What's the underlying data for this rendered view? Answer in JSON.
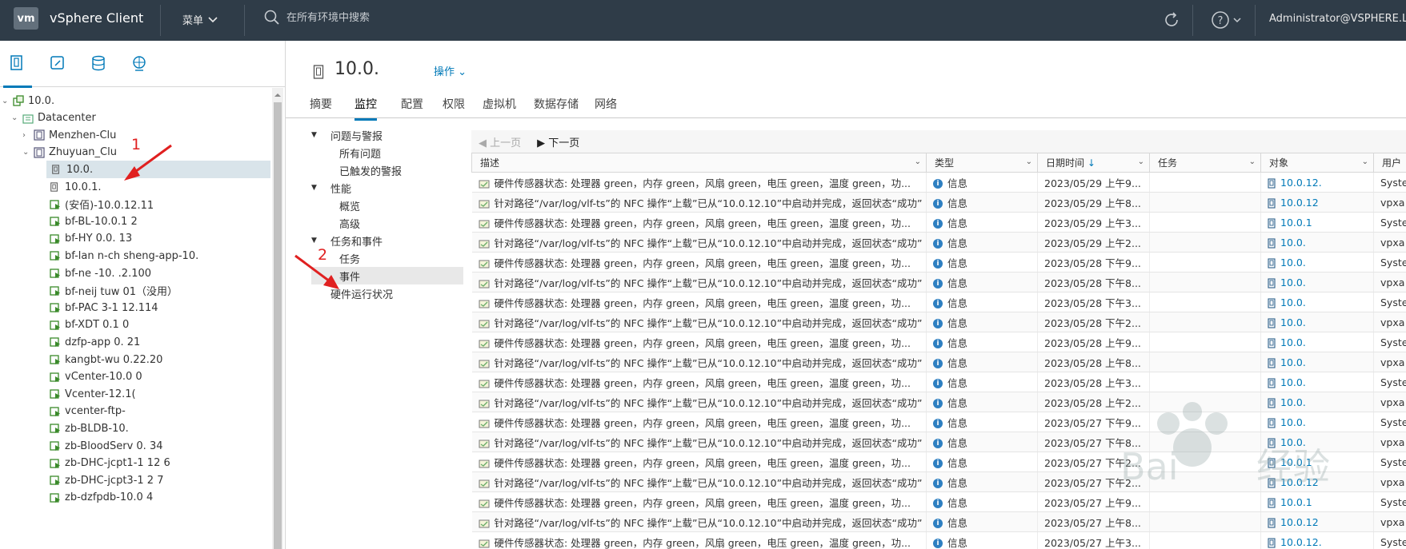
{
  "header": {
    "logo": "vm",
    "app_title": "vSphere Client",
    "menu_label": "菜单",
    "search_placeholder": "在所有环境中搜索",
    "user": "Administrator@VSPHERE.L"
  },
  "nav": {
    "tabs": [
      "hosts-clusters-icon",
      "vms-templates-icon",
      "storage-icon",
      "networking-icon"
    ],
    "tree": [
      {
        "label": "10.0.",
        "level": 0,
        "caret": "down",
        "icon": "vcenter"
      },
      {
        "label": "Datacenter",
        "level": 1,
        "caret": "down",
        "icon": "datacenter"
      },
      {
        "label": "Menzhen-Clu",
        "level": 2,
        "caret": "right",
        "icon": "cluster"
      },
      {
        "label": "Zhuyuan_Clu",
        "level": 2,
        "caret": "down",
        "icon": "cluster"
      },
      {
        "label": "10.0.",
        "level": 3,
        "caret": "",
        "icon": "host",
        "selected": true
      },
      {
        "label": "10.0.1.",
        "level": 3,
        "caret": "",
        "icon": "host"
      },
      {
        "label": "(安佰)-10.0.12.11",
        "level": 3,
        "caret": "",
        "icon": "vm"
      },
      {
        "label": "bf-BL-10.0.1 2",
        "level": 3,
        "caret": "",
        "icon": "vm"
      },
      {
        "label": "bf-HY 0.0. 13",
        "level": 3,
        "caret": "",
        "icon": "vm"
      },
      {
        "label": "bf-lan n-ch sheng-app-10.",
        "level": 3,
        "caret": "",
        "icon": "vm"
      },
      {
        "label": "bf-ne -10. .2.100",
        "level": 3,
        "caret": "",
        "icon": "vm"
      },
      {
        "label": "bf-neij tuw 01（没用）",
        "level": 3,
        "caret": "",
        "icon": "vm"
      },
      {
        "label": "bf-PAC 3-1 12.114",
        "level": 3,
        "caret": "",
        "icon": "vm"
      },
      {
        "label": "bf-XDT 0.1 0",
        "level": 3,
        "caret": "",
        "icon": "vm"
      },
      {
        "label": "dzfp-app 0. 21",
        "level": 3,
        "caret": "",
        "icon": "vm"
      },
      {
        "label": "kangbt-wu 0.22.20",
        "level": 3,
        "caret": "",
        "icon": "vm"
      },
      {
        "label": "vCenter-10.0 0",
        "level": 3,
        "caret": "",
        "icon": "vm"
      },
      {
        "label": "Vcenter-12.1(",
        "level": 3,
        "caret": "",
        "icon": "vm"
      },
      {
        "label": "vcenter-ftp-",
        "level": 3,
        "caret": "",
        "icon": "vm"
      },
      {
        "label": "zb-BLDB-10.",
        "level": 3,
        "caret": "",
        "icon": "vm"
      },
      {
        "label": "zb-BloodServ 0. 34",
        "level": 3,
        "caret": "",
        "icon": "vm"
      },
      {
        "label": "zb-DHC-jcpt1-1 12 6",
        "level": 3,
        "caret": "",
        "icon": "vm"
      },
      {
        "label": "zb-DHC-jcpt3-1 2 7",
        "level": 3,
        "caret": "",
        "icon": "vm"
      },
      {
        "label": "zb-dzfpdb-10.0 4",
        "level": 3,
        "caret": "",
        "icon": "vm"
      }
    ]
  },
  "object": {
    "title": "10.0.",
    "actions_label": "操作"
  },
  "tabs": [
    {
      "label": "摘要",
      "active": false
    },
    {
      "label": "监控",
      "active": true
    },
    {
      "label": "配置",
      "active": false
    },
    {
      "label": "权限",
      "active": false
    },
    {
      "label": "虚拟机",
      "active": false
    },
    {
      "label": "数据存储",
      "active": false
    },
    {
      "label": "网络",
      "active": false
    }
  ],
  "subnav": {
    "group1": "问题与警报",
    "g1_items": [
      "所有问题",
      "已触发的警报"
    ],
    "group2": "性能",
    "g2_items": [
      "概览",
      "高级"
    ],
    "group3": "任务和事件",
    "g3_items": [
      "任务",
      "事件"
    ],
    "other": "硬件运行状况"
  },
  "pager": {
    "prev": "上一页",
    "next": "下一页"
  },
  "grid": {
    "columns": [
      "描述",
      "类型",
      "日期时间",
      "任务",
      "对象",
      "用户"
    ],
    "type_label": "信息",
    "rows": [
      {
        "desc": "硬件传感器状态: 处理器 green，内存 green，风扇 green，电压 green，温度 green，功...",
        "date": "2023/05/29 上午9...",
        "obj": "10.0.12.",
        "user": "Syste"
      },
      {
        "desc": "针对路径“/var/log/vlf-ts”的 NFC 操作“上载”已从“10.0.12.10”中启动并完成，返回状态“成功”",
        "date": "2023/05/29 上午8...",
        "obj": "10.0.12",
        "user": "vpxa"
      },
      {
        "desc": "硬件传感器状态: 处理器 green，内存 green，风扇 green，电压 green，温度 green，功...",
        "date": "2023/05/29 上午3...",
        "obj": "10.0.1",
        "user": "Syste"
      },
      {
        "desc": "针对路径“/var/log/vlf-ts”的 NFC 操作“上载”已从“10.0.12.10”中启动并完成，返回状态“成功”",
        "date": "2023/05/29 上午2...",
        "obj": "10.0.",
        "user": "vpxa"
      },
      {
        "desc": "硬件传感器状态: 处理器 green，内存 green，风扇 green，电压 green，温度 green，功...",
        "date": "2023/05/28 下午9...",
        "obj": "10.0.",
        "user": "Syste"
      },
      {
        "desc": "针对路径“/var/log/vlf-ts”的 NFC 操作“上载”已从“10.0.12.10”中启动并完成，返回状态“成功”",
        "date": "2023/05/28 下午8...",
        "obj": "10.0.",
        "user": "vpxa"
      },
      {
        "desc": "硬件传感器状态: 处理器 green，内存 green，风扇 green，电压 green，温度 green，功...",
        "date": "2023/05/28 下午3...",
        "obj": "10.0.",
        "user": "Syste"
      },
      {
        "desc": "针对路径“/var/log/vlf-ts”的 NFC 操作“上载”已从“10.0.12.10”中启动并完成，返回状态“成功”",
        "date": "2023/05/28 下午2...",
        "obj": "10.0.",
        "user": "vpxa"
      },
      {
        "desc": "硬件传感器状态: 处理器 green，内存 green，风扇 green，电压 green，温度 green，功...",
        "date": "2023/05/28 上午9...",
        "obj": "10.0.",
        "user": "Syste"
      },
      {
        "desc": "针对路径“/var/log/vlf-ts”的 NFC 操作“上载”已从“10.0.12.10”中启动并完成，返回状态“成功”",
        "date": "2023/05/28 上午8...",
        "obj": "10.0.",
        "user": "vpxa"
      },
      {
        "desc": "硬件传感器状态: 处理器 green，内存 green，风扇 green，电压 green，温度 green，功...",
        "date": "2023/05/28 上午3...",
        "obj": "10.0.",
        "user": "Syste"
      },
      {
        "desc": "针对路径“/var/log/vlf-ts”的 NFC 操作“上载”已从“10.0.12.10”中启动并完成，返回状态“成功”",
        "date": "2023/05/28 上午2...",
        "obj": "10.0.",
        "user": "vpxa"
      },
      {
        "desc": "硬件传感器状态: 处理器 green，内存 green，风扇 green，电压 green，温度 green，功...",
        "date": "2023/05/27 下午9...",
        "obj": "10.0.",
        "user": "Syste"
      },
      {
        "desc": "针对路径“/var/log/vlf-ts”的 NFC 操作“上载”已从“10.0.12.10”中启动并完成，返回状态“成功”",
        "date": "2023/05/27 下午8...",
        "obj": "10.0.",
        "user": "vpxa"
      },
      {
        "desc": "硬件传感器状态: 处理器 green，内存 green，风扇 green，电压 green，温度 green，功...",
        "date": "2023/05/27 下午2...",
        "obj": "10.0.1",
        "user": "Syste"
      },
      {
        "desc": "针对路径“/var/log/vlf-ts”的 NFC 操作“上载”已从“10.0.12.10”中启动并完成，返回状态“成功”",
        "date": "2023/05/27 下午2...",
        "obj": "10.0.12",
        "user": "vpxa"
      },
      {
        "desc": "硬件传感器状态: 处理器 green，内存 green，风扇 green，电压 green，温度 green，功...",
        "date": "2023/05/27 上午9...",
        "obj": "10.0.1",
        "user": "Syste"
      },
      {
        "desc": "针对路径“/var/log/vlf-ts”的 NFC 操作“上载”已从“10.0.12.10”中启动并完成，返回状态“成功”",
        "date": "2023/05/27 上午8...",
        "obj": "10.0.12",
        "user": "vpxa"
      },
      {
        "desc": "硬件传感器状态: 处理器 green，内存 green，风扇 green，电压 green，温度 green，功...",
        "date": "2023/05/27 上午3...",
        "obj": "10.0.12.",
        "user": "Syste"
      }
    ]
  },
  "annotations": {
    "n1": "1",
    "n2": "2"
  },
  "colors": {
    "header_bg": "#2f3c48",
    "accent": "#0079b8",
    "annotation": "#e02020"
  }
}
